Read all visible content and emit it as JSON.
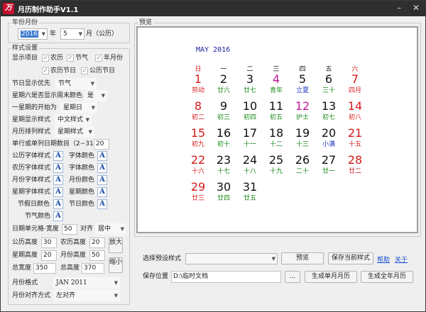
{
  "window": {
    "title": "月历制作助手V1.1",
    "icon_glyph": "万"
  },
  "year_month": {
    "group_label": "年份月份",
    "year_value": "2016",
    "year_label": "年",
    "month_value": "5",
    "month_label": "月（公历）"
  },
  "style": {
    "group_label": "样式设置",
    "display_items_label": "显示项目",
    "checkboxes": [
      {
        "label": "农历",
        "checked": true
      },
      {
        "label": "节气",
        "checked": true
      },
      {
        "label": "年月份",
        "checked": true
      },
      {
        "label": "农历节日",
        "checked": true
      },
      {
        "label": "公历节日",
        "checked": true
      }
    ],
    "holiday_priority_label": "节日显示优先",
    "holiday_priority_value": "节气",
    "weekend_red_label": "星期六是否显示周末颜色",
    "weekend_red_value": "是",
    "week_start_label": "一星期的开始为",
    "week_start_value": "星期日",
    "week_display_label": "星期显示样式",
    "week_display_value": "中文样式",
    "month_arrange_label": "月历排列样式",
    "month_arrange_value": "星期样式",
    "row_days_label": "单行或单列日期数目（2~31）",
    "row_days_value": "20",
    "font_rows": [
      {
        "left": "公历字体样式",
        "right": "字体颜色"
      },
      {
        "left": "农历字体样式",
        "right": "字体颜色"
      },
      {
        "left": "月份字体样式",
        "right": "月份颜色"
      },
      {
        "left": "星期字体样式",
        "right": "星期颜色"
      },
      {
        "left": "节假日颜色",
        "right": "节日颜色"
      },
      {
        "left": "节气颜色",
        "right": ""
      }
    ],
    "font_button_glyph": "A",
    "cell_label": "日期单元格·宽度",
    "cell_width": "50",
    "align_label": "对齐",
    "align_value": "居中",
    "gregorian_height_label": "公历高度",
    "gregorian_height": "30",
    "lunar_height_label": "农历高度",
    "lunar_height": "20",
    "week_height_label": "星期高度",
    "week_height": "20",
    "month_height_label": "月份高度",
    "month_height": "50",
    "total_width_label": "总宽度",
    "total_width": "350",
    "total_height_label": "总高度",
    "total_height": "370",
    "zoom_in_label": "放大",
    "zoom_out_label": "缩小",
    "month_format_label": "月份格式",
    "month_format_value": "JAN 2011",
    "month_align_label": "月份对齐方式",
    "month_align_value": "左对齐"
  },
  "preview": {
    "group_label": "预览",
    "calendar": {
      "title": "MAY 2016",
      "weekdays": [
        "日",
        "一",
        "二",
        "三",
        "四",
        "五",
        "六"
      ],
      "rows": [
        [
          {
            "day": "1",
            "sub": "劳动",
            "day_color": "#d61a1a",
            "sub_color": "#d61a1a"
          },
          {
            "day": "2",
            "sub": "廿六",
            "day_color": "#111111",
            "sub_color": "#1a8a1a"
          },
          {
            "day": "3",
            "sub": "廿七",
            "day_color": "#111111",
            "sub_color": "#1a8a1a"
          },
          {
            "day": "4",
            "sub": "青年",
            "day_color": "#c2179a",
            "sub_color": "#1a8a1a"
          },
          {
            "day": "5",
            "sub": "立夏",
            "day_color": "#111111",
            "sub_color": "#1a2fbf"
          },
          {
            "day": "6",
            "sub": "三十",
            "day_color": "#111111",
            "sub_color": "#1a8a1a"
          },
          {
            "day": "7",
            "sub": "四月",
            "day_color": "#d61a1a",
            "sub_color": "#d61a1a"
          }
        ],
        [
          {
            "day": "8",
            "sub": "初二",
            "day_color": "#d61a1a",
            "sub_color": "#d61a1a"
          },
          {
            "day": "9",
            "sub": "初三",
            "day_color": "#111111",
            "sub_color": "#1a8a1a"
          },
          {
            "day": "10",
            "sub": "初四",
            "day_color": "#111111",
            "sub_color": "#1a8a1a"
          },
          {
            "day": "11",
            "sub": "初五",
            "day_color": "#111111",
            "sub_color": "#1a8a1a"
          },
          {
            "day": "12",
            "sub": "护士",
            "day_color": "#c2179a",
            "sub_color": "#1a8a1a"
          },
          {
            "day": "13",
            "sub": "初七",
            "day_color": "#111111",
            "sub_color": "#1a8a1a"
          },
          {
            "day": "14",
            "sub": "初八",
            "day_color": "#d61a1a",
            "sub_color": "#d61a1a"
          }
        ],
        [
          {
            "day": "15",
            "sub": "初九",
            "day_color": "#d61a1a",
            "sub_color": "#d61a1a"
          },
          {
            "day": "16",
            "sub": "初十",
            "day_color": "#111111",
            "sub_color": "#1a8a1a"
          },
          {
            "day": "17",
            "sub": "十一",
            "day_color": "#111111",
            "sub_color": "#1a8a1a"
          },
          {
            "day": "18",
            "sub": "十二",
            "day_color": "#111111",
            "sub_color": "#1a8a1a"
          },
          {
            "day": "19",
            "sub": "十三",
            "day_color": "#111111",
            "sub_color": "#1a8a1a"
          },
          {
            "day": "20",
            "sub": "小满",
            "day_color": "#111111",
            "sub_color": "#1a2fbf"
          },
          {
            "day": "21",
            "sub": "十五",
            "day_color": "#d61a1a",
            "sub_color": "#d61a1a"
          }
        ],
        [
          {
            "day": "22",
            "sub": "十六",
            "day_color": "#d61a1a",
            "sub_color": "#d61a1a"
          },
          {
            "day": "23",
            "sub": "十七",
            "day_color": "#111111",
            "sub_color": "#1a8a1a"
          },
          {
            "day": "24",
            "sub": "十八",
            "day_color": "#111111",
            "sub_color": "#1a8a1a"
          },
          {
            "day": "25",
            "sub": "十九",
            "day_color": "#111111",
            "sub_color": "#1a8a1a"
          },
          {
            "day": "26",
            "sub": "二十",
            "day_color": "#111111",
            "sub_color": "#1a8a1a"
          },
          {
            "day": "27",
            "sub": "廿一",
            "day_color": "#111111",
            "sub_color": "#1a8a1a"
          },
          {
            "day": "28",
            "sub": "廿二",
            "day_color": "#d61a1a",
            "sub_color": "#d61a1a"
          }
        ],
        [
          {
            "day": "29",
            "sub": "廿三",
            "day_color": "#d61a1a",
            "sub_color": "#d61a1a"
          },
          {
            "day": "30",
            "sub": "廿四",
            "day_color": "#111111",
            "sub_color": "#1a8a1a"
          },
          {
            "day": "31",
            "sub": "廿五",
            "day_color": "#111111",
            "sub_color": "#1a8a1a"
          }
        ]
      ]
    }
  },
  "bottom": {
    "preset_label": "选择预设样式",
    "preset_value": "",
    "preview_button": "预览",
    "save_style_button": "保存当前样式",
    "help_link": "帮助",
    "about_link": "关于",
    "save_location_label": "保存位置",
    "save_location_value": "D:\\临时文档",
    "browse_button": "...",
    "gen_month_button": "生成单月月历",
    "gen_year_button": "生成全年月历"
  },
  "colors": {
    "weekend_red": "#d61a1a",
    "holiday_magenta": "#c2179a",
    "lunar_green": "#1a8a1a",
    "solar_term_blue": "#1a2fbf",
    "title_navy": "#1b1f9c"
  }
}
